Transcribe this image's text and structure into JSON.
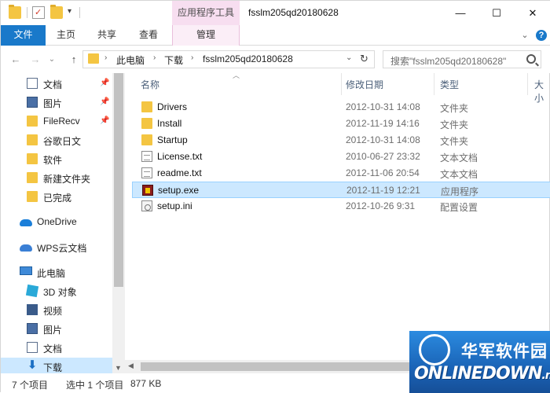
{
  "titlebar": {
    "context_tab": "应用程序工具",
    "title": "fsslm205qd20180628",
    "minimize": "—",
    "maximize": "☐",
    "close": "✕"
  },
  "ribbon": {
    "tabs": [
      "文件",
      "主页",
      "共享",
      "查看",
      "管理"
    ],
    "collapse": "⌄",
    "help": "?"
  },
  "address": {
    "back": "←",
    "forward": "→",
    "recent": "⌄",
    "up": "↑",
    "segments": [
      "此电脑",
      "下载",
      "fsslm205qd20180628"
    ],
    "dropdown": "⌄",
    "refresh": "↻"
  },
  "search": {
    "placeholder": "搜索\"fsslm205qd20180628\""
  },
  "navpane": {
    "quick_access": [
      {
        "label": "文档",
        "icon": "document-icon",
        "pinned": true
      },
      {
        "label": "图片",
        "icon": "pictures-icon",
        "pinned": true
      },
      {
        "label": "FileRecv",
        "icon": "folder-icon",
        "pinned": true
      },
      {
        "label": "谷歌日文",
        "icon": "folder-icon",
        "pinned": false
      },
      {
        "label": "软件",
        "icon": "folder-icon",
        "pinned": false
      },
      {
        "label": "新建文件夹",
        "icon": "folder-icon",
        "pinned": false
      },
      {
        "label": "已完成",
        "icon": "folder-icon",
        "pinned": false
      }
    ],
    "onedrive": "OneDrive",
    "wps": "WPS云文档",
    "this_pc": "此电脑",
    "pc_items": [
      {
        "label": "3D 对象",
        "icon": "3d-objects-icon"
      },
      {
        "label": "视频",
        "icon": "videos-icon"
      },
      {
        "label": "图片",
        "icon": "pictures-icon"
      },
      {
        "label": "文档",
        "icon": "document-icon"
      },
      {
        "label": "下载",
        "icon": "download-icon"
      }
    ]
  },
  "columns": [
    "名称",
    "修改日期",
    "类型",
    "大小"
  ],
  "files": [
    {
      "name": "Drivers",
      "date": "2012-10-31 14:08",
      "type": "文件夹",
      "icon": "folder-icon"
    },
    {
      "name": "Install",
      "date": "2012-11-19 14:16",
      "type": "文件夹",
      "icon": "folder-icon"
    },
    {
      "name": "Startup",
      "date": "2012-10-31 14:08",
      "type": "文件夹",
      "icon": "folder-icon"
    },
    {
      "name": "License.txt",
      "date": "2010-06-27 23:32",
      "type": "文本文档",
      "icon": "text-file-icon"
    },
    {
      "name": "readme.txt",
      "date": "2012-11-06 20:54",
      "type": "文本文档",
      "icon": "text-file-icon"
    },
    {
      "name": "setup.exe",
      "date": "2012-11-19 12:21",
      "type": "应用程序",
      "icon": "exe-icon",
      "selected": true
    },
    {
      "name": "setup.ini",
      "date": "2012-10-26 9:31",
      "type": "配置设置",
      "icon": "ini-file-icon"
    }
  ],
  "status": {
    "count": "7 个项目",
    "selected": "选中 1 个项目",
    "size": "877 KB"
  },
  "watermark": {
    "cn": "华军软件园",
    "en": "ONLINEDOWN",
    "domain": ".net"
  }
}
